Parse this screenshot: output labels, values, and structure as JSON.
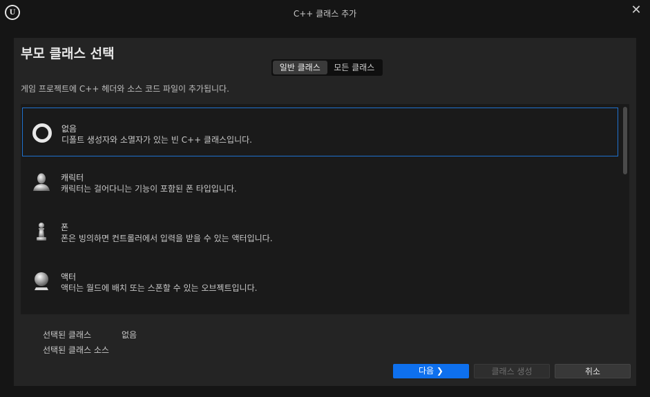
{
  "window": {
    "title": "C++ 클래스 추가",
    "logo_icon": "unreal-logo-icon",
    "logo_glyph": "U",
    "close_glyph": "✕"
  },
  "page": {
    "title": "부모 클래스 선택",
    "description": "게임 프로젝트에 C++ 헤더와 소스 코드 파일이 추가됩니다."
  },
  "class_toggle": {
    "options": [
      "일반 클래스",
      "모든 클래스"
    ],
    "selected": "일반 클래스"
  },
  "class_list": {
    "items": [
      {
        "name": "없음",
        "description": "디폴트 생성자와 소멸자가 있는 빈 C++ 클래스입니다.",
        "icon": "empty-ring-icon",
        "selected": true
      },
      {
        "name": "캐릭터",
        "description": "캐릭터는 걸어다니는 기능이 포함된 폰 타입입니다.",
        "icon": "character-icon",
        "selected": false
      },
      {
        "name": "폰",
        "description": "폰은 빙의하면 컨트롤러에서 입력을 받을 수 있는 액터입니다.",
        "icon": "pawn-icon",
        "selected": false
      },
      {
        "name": "액터",
        "description": "액터는 월드에 배치 또는 스폰할 수 있는 오브젝트입니다.",
        "icon": "actor-sphere-icon",
        "selected": false
      }
    ]
  },
  "selection_info": {
    "selected_class_label": "선택된 클래스",
    "selected_class_value": "없음",
    "selected_class_source_label": "선택된 클래스 소스"
  },
  "buttons": {
    "next": "다음 ❯",
    "create": "클래스 생성",
    "cancel": "취소"
  },
  "colors": {
    "accent": "#0e70ee",
    "selection_border": "#1f72d0"
  }
}
